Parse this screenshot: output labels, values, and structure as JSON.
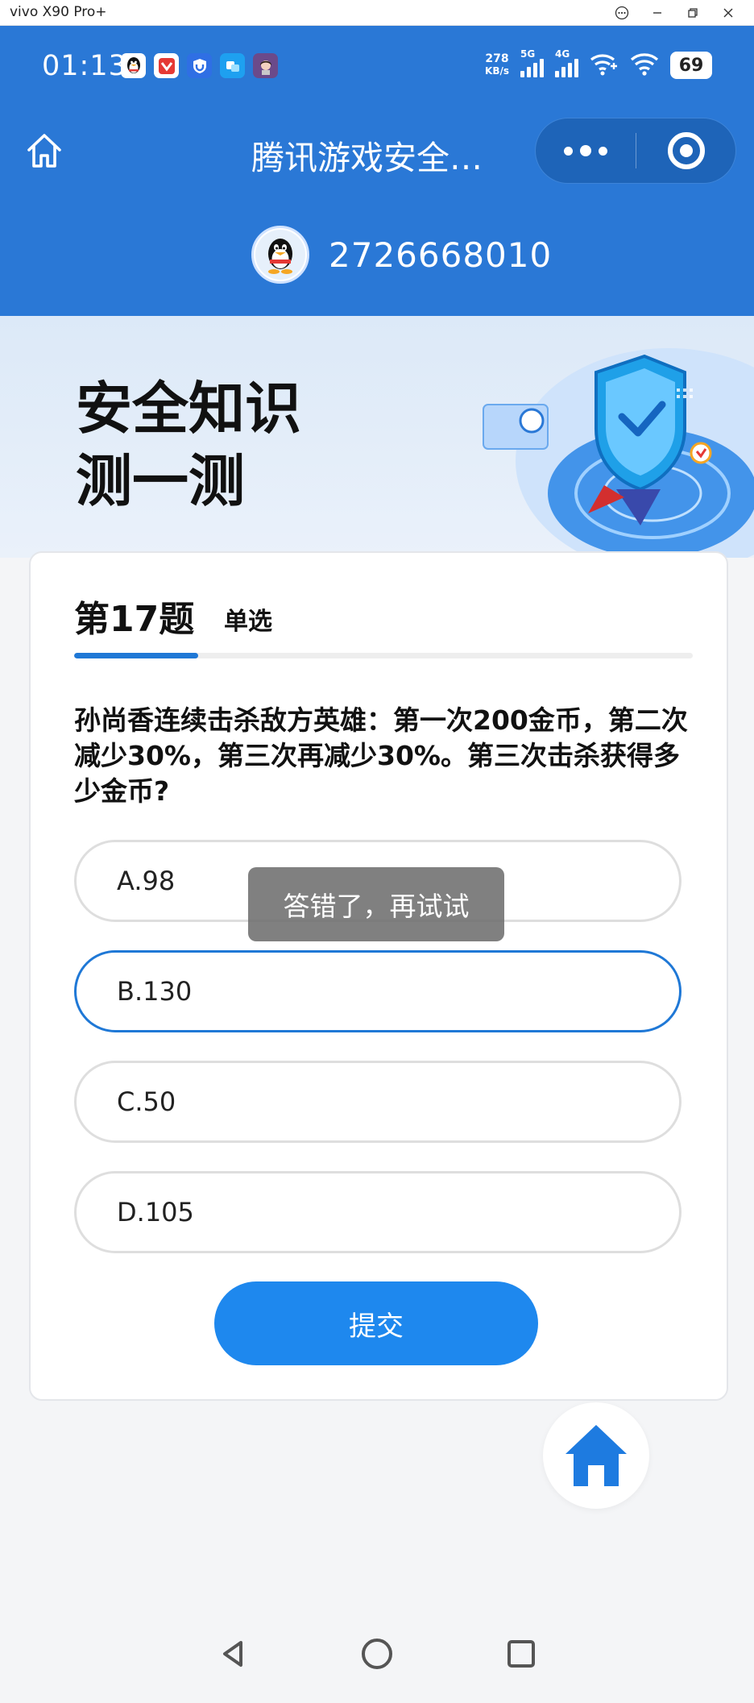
{
  "window": {
    "title": "vivo X90 Pro+",
    "controls": [
      "more-icon",
      "minimize-icon",
      "restore-icon",
      "close-icon"
    ]
  },
  "status_bar": {
    "time": "01:13",
    "net_speed_value": "278",
    "net_speed_unit": "KB/s",
    "sim1": "5G",
    "sim2": "4G",
    "battery": "69"
  },
  "nav": {
    "title": "腾讯游戏安全…",
    "home_icon": "home-outline-icon",
    "more_icon": "more-dots-icon",
    "close_icon": "target-circle-icon"
  },
  "user": {
    "qq_number": "2726668010",
    "avatar_icon": "qq-penguin-icon"
  },
  "hero": {
    "title_line1": "安全知识",
    "title_line2": "测一测"
  },
  "quiz": {
    "question_number": "第17题",
    "question_type": "单选",
    "progress_fraction": 0.2,
    "question": "孙尚香连续击杀敌方英雄：第一次200金币，第二次减少30%，第三次再减少30%。第三次击杀获得多少金币?",
    "options": [
      {
        "label": "A.98",
        "selected": false
      },
      {
        "label": "B.130",
        "selected": true
      },
      {
        "label": "C.50",
        "selected": false
      },
      {
        "label": "D.105",
        "selected": false
      }
    ],
    "submit_label": "提交"
  },
  "toast": {
    "message": "答错了，再试试"
  },
  "colors": {
    "header_blue": "#2a78d6",
    "accent_blue": "#1f78d6",
    "submit_blue": "#1e88ee"
  }
}
